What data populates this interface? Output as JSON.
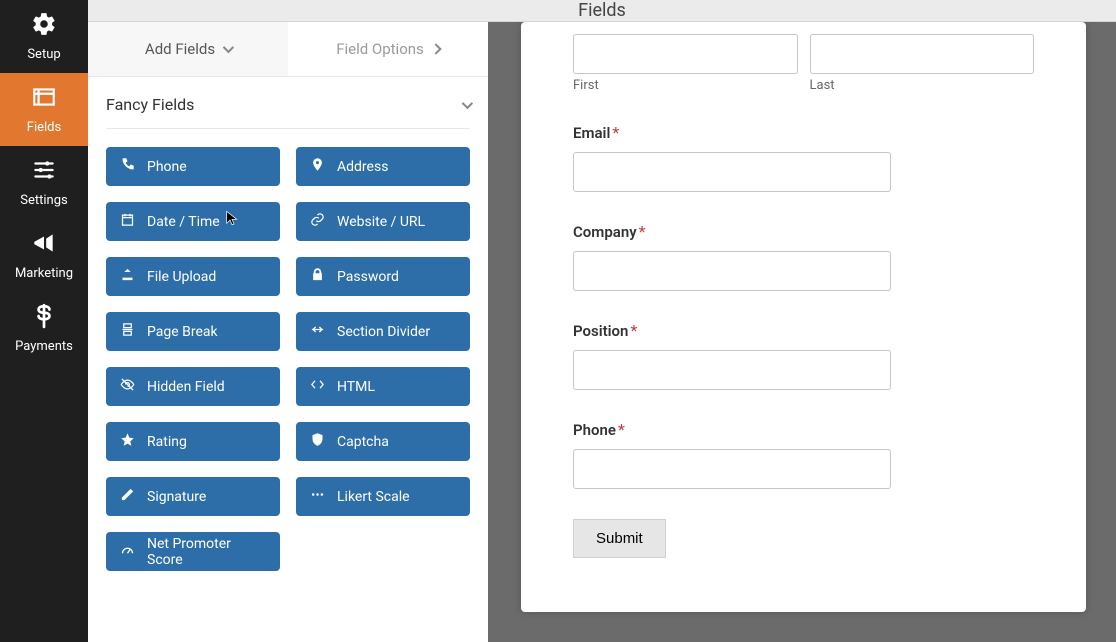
{
  "sidebar": [
    {
      "name": "setup",
      "label": "Setup",
      "icon": "gear-icon"
    },
    {
      "name": "fields",
      "label": "Fields",
      "icon": "form-icon"
    },
    {
      "name": "settings",
      "label": "Settings",
      "icon": "sliders-icon"
    },
    {
      "name": "marketing",
      "label": "Marketing",
      "icon": "megaphone-icon"
    },
    {
      "name": "payments",
      "label": "Payments",
      "icon": "dollar-icon"
    }
  ],
  "topbar": {
    "title": "Fields"
  },
  "tabs": {
    "add": "Add Fields",
    "options": "Field Options"
  },
  "group": {
    "title": "Fancy Fields"
  },
  "fields": [
    {
      "name": "phone",
      "label": "Phone",
      "icon": "phone-icon"
    },
    {
      "name": "address",
      "label": "Address",
      "icon": "pin-icon"
    },
    {
      "name": "datetime",
      "label": "Date / Time",
      "icon": "calendar-icon"
    },
    {
      "name": "url",
      "label": "Website / URL",
      "icon": "link-icon"
    },
    {
      "name": "upload",
      "label": "File Upload",
      "icon": "upload-icon"
    },
    {
      "name": "password",
      "label": "Password",
      "icon": "lock-icon"
    },
    {
      "name": "pagebreak",
      "label": "Page Break",
      "icon": "pagebreak-icon"
    },
    {
      "name": "divider",
      "label": "Section Divider",
      "icon": "divider-icon"
    },
    {
      "name": "hidden",
      "label": "Hidden Field",
      "icon": "eye-off-icon"
    },
    {
      "name": "html",
      "label": "HTML",
      "icon": "code-icon"
    },
    {
      "name": "rating",
      "label": "Rating",
      "icon": "star-icon"
    },
    {
      "name": "captcha",
      "label": "Captcha",
      "icon": "shield-icon"
    },
    {
      "name": "signature",
      "label": "Signature",
      "icon": "pencil-icon"
    },
    {
      "name": "likert",
      "label": "Likert Scale",
      "icon": "dots-icon"
    },
    {
      "name": "nps",
      "label": "Net Promoter Score",
      "icon": "gauge-icon"
    }
  ],
  "form": {
    "first": "First",
    "last": "Last",
    "email": "Email",
    "company": "Company",
    "position": "Position",
    "phone": "Phone",
    "submit": "Submit",
    "required": "*"
  }
}
